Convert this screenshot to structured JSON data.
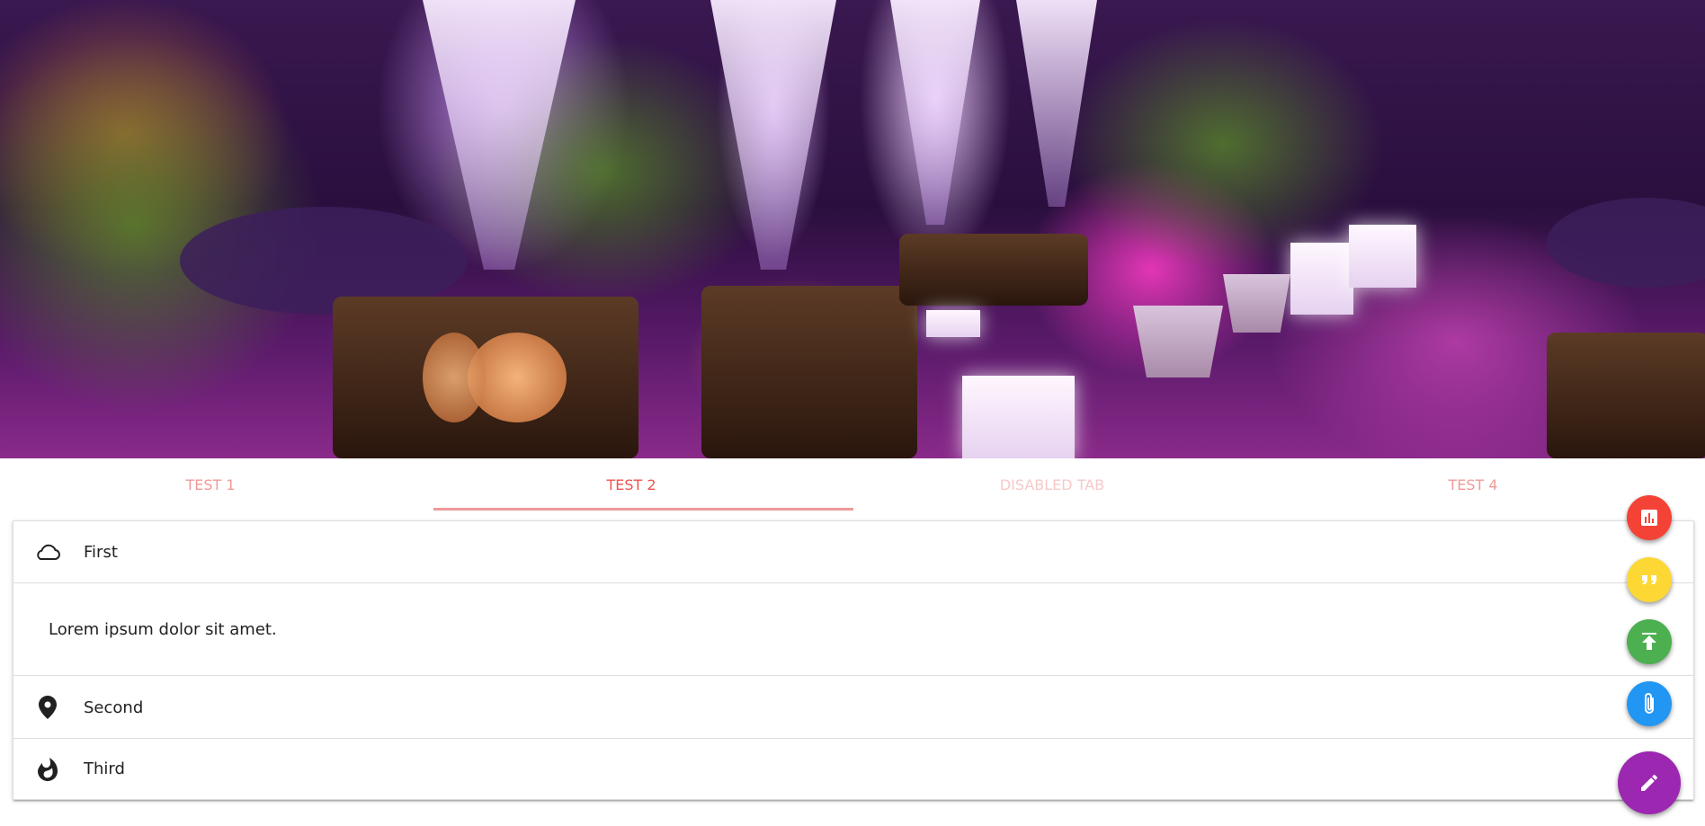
{
  "hero": {
    "image_subject": "event-lounge-photo"
  },
  "tabs": [
    {
      "label": "Test 1",
      "state": "normal"
    },
    {
      "label": "Test 2",
      "state": "active"
    },
    {
      "label": "Disabled Tab",
      "state": "disabled"
    },
    {
      "label": "Test 4",
      "state": "normal"
    }
  ],
  "collapsible": {
    "items": [
      {
        "label": "First",
        "icon": "cloud-icon",
        "expanded": true,
        "body": "Lorem ipsum dolor sit amet."
      },
      {
        "label": "Second",
        "icon": "place-icon",
        "expanded": false
      },
      {
        "label": "Third",
        "icon": "whatshot-icon",
        "expanded": false
      }
    ]
  },
  "fab_menu": {
    "main": {
      "icon": "edit-icon",
      "color": "#9c27b0"
    },
    "actions": [
      {
        "icon": "insert-chart-icon",
        "color": "#f44336"
      },
      {
        "icon": "format-quote-icon",
        "color": "#fdd835"
      },
      {
        "icon": "publish-icon",
        "color": "#4caf50"
      },
      {
        "icon": "attach-file-icon",
        "color": "#2196f3"
      }
    ]
  },
  "colors": {
    "tab_text": "#ef9a9a",
    "tab_active_text": "#ef5350",
    "tab_indicator": "#ef9a9a"
  }
}
